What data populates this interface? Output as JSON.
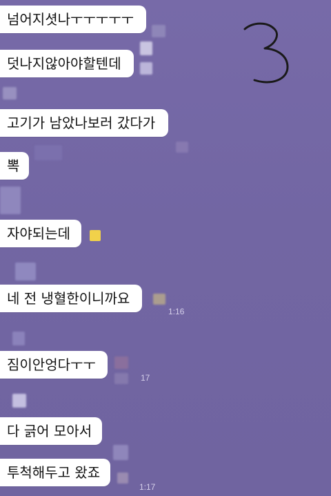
{
  "annotation": "3",
  "colors": {
    "background": "#7468a6",
    "bubble": "#ffffff",
    "timestamp": "#d6d0ea",
    "sticker": "#f1d14a"
  },
  "messages": [
    {
      "text": "넘어지셧나ㅜㅜㅜㅜㅜ"
    },
    {
      "text": "덧나지않아야할텐데"
    },
    {
      "text": "고기가 남았나보러 갔다가"
    },
    {
      "text": "뽁"
    },
    {
      "text": "자야되는데"
    },
    {
      "text": "네 전 냉혈한이니까요"
    },
    {
      "text": "짐이안엉다ㅜㅜ"
    },
    {
      "text": "다 긁어 모아서"
    },
    {
      "text": "투척해두고 왔죠"
    }
  ],
  "timestamps": {
    "t1": "1:16",
    "t2": "17",
    "t3": "1:17"
  }
}
